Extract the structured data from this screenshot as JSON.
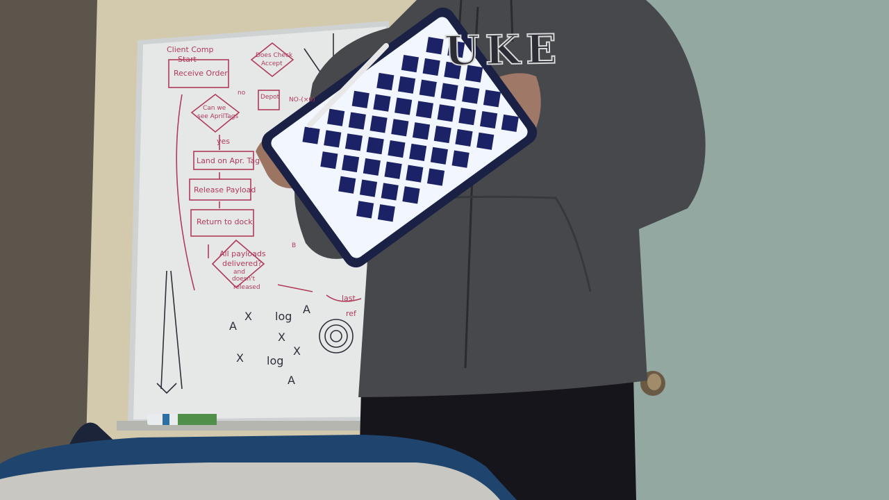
{
  "scene": {
    "description_items": [
      "wall",
      "whiteboard",
      "person-in-hoodie",
      "tablet-with-checkerboard",
      "chair-back",
      "door-knob",
      "marker"
    ]
  },
  "whiteboard": {
    "texts": {
      "client_comp": "Client Comp",
      "start": "Start",
      "receive_order": "Receive Order",
      "does_check": "Does Check",
      "accept": "Accept",
      "no": "no",
      "depot": "Depot",
      "no_paren": "NO-(×6)",
      "can_we_see": "Can we",
      "see_apriltags": "see AprilTags",
      "yes": "yes",
      "land_on_apriltag": "Land on Apr. Tag",
      "release_payload": "Release Payload",
      "return_to_dock": "Return to dock",
      "all_payloads": "All payloads",
      "delivered": "delivered?",
      "and": "and",
      "doesn_t": "doesn't",
      "released": "released",
      "last": "last",
      "ref": "ref",
      "b_char": "B",
      "ax": "A",
      "xa": "X",
      "log_a_x": "log",
      "log_x_a": "log",
      "a_char": "A",
      "x_char": "X"
    }
  },
  "hoodie": {
    "letters": "UKE"
  },
  "tablet": {
    "rows": 8,
    "cols": 6,
    "screen_color": "#f2f6ff",
    "square_color": "#1c2266"
  },
  "colors": {
    "wall_left": "#5e564c",
    "wall_beige": "#d8cfb2",
    "wall_teal": "#8fa39b",
    "whiteboard": "#e4e6e6",
    "hoodie": "#45474b",
    "pants": "#14141a",
    "chair_blue": "#20456f",
    "chair_gray": "#c9c7c2",
    "marker_ink": "#b03a5a"
  }
}
